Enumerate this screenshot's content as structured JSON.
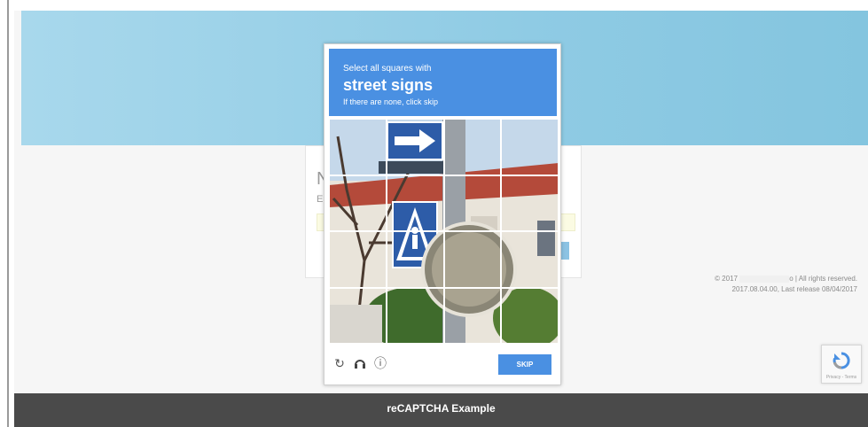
{
  "login_card": {
    "title_fragment": "N",
    "subtitle_fragment": "E"
  },
  "captcha": {
    "prompt": "Select all squares with",
    "object": "street signs",
    "hint": "If there are none, click skip",
    "grid_rows": 4,
    "grid_cols": 4,
    "controls": {
      "reload_icon": "reload-icon",
      "audio_icon": "headphones-icon",
      "info_icon": "info-icon",
      "skip_label": "SKIP"
    },
    "colors": {
      "header": "#4a90e2",
      "button": "#4a90e2"
    }
  },
  "copyright": {
    "line1_prefix": "© 2017",
    "line1_suffix": "o | All rights reserved.",
    "line2": "2017.08.04.00, Last release 08/04/2017"
  },
  "badge": {
    "text": "Privacy - Terms"
  },
  "footer": {
    "title": "reCAPTCHA Example"
  }
}
